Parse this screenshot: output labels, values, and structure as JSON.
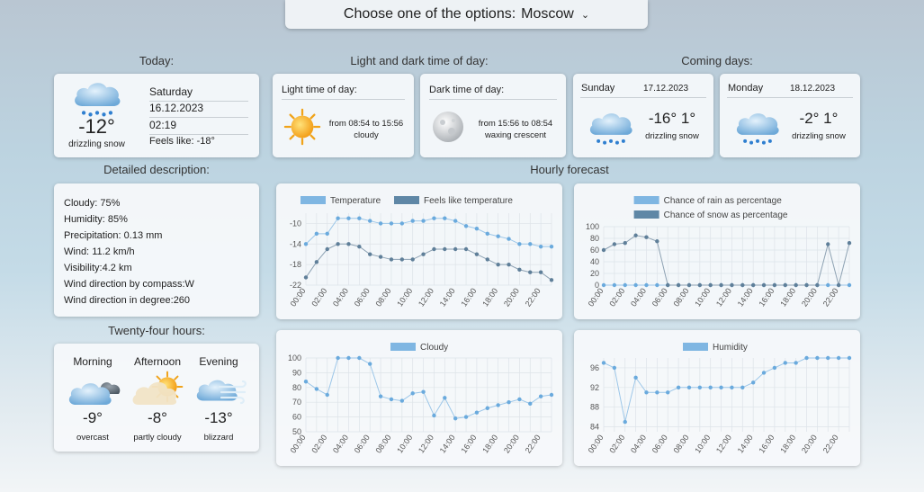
{
  "header": {
    "prompt": "Choose one of the options:",
    "city": "Moscow"
  },
  "sections": {
    "today": "Today:",
    "light_dark": "Light and dark time of day:",
    "coming": "Coming days:",
    "detailed": "Detailed description:",
    "hourly": "Hourly forecast",
    "twentyfour": "Twenty-four hours:"
  },
  "today": {
    "day": "Saturday",
    "date": "16.12.2023",
    "time": "02:19",
    "feels": "Feels like: -18°",
    "temp": "-12°",
    "desc": "drizzling snow",
    "icon": "snow-cloud-icon"
  },
  "light": {
    "title": "Light time of day:",
    "range": "from 08:54 to 15:56",
    "desc": "cloudy",
    "icon": "sun-icon"
  },
  "dark": {
    "title": "Dark time of day:",
    "range": "from 15:56 to 08:54",
    "desc": "waxing crescent",
    "icon": "moon-icon"
  },
  "coming": [
    {
      "day": "Sunday",
      "date": "17.12.2023",
      "temp": "-16° 1°",
      "desc": "drizzling snow",
      "icon": "snow-cloud-icon"
    },
    {
      "day": "Monday",
      "date": "18.12.2023",
      "temp": "-2° 1°",
      "desc": "drizzling snow",
      "icon": "snow-cloud-icon"
    }
  ],
  "detailed": [
    {
      "label": "Cloudy:",
      "value": "75%"
    },
    {
      "label": "Humidity:",
      "value": "85%"
    },
    {
      "label": "Precipitation:",
      "value": "0.13 mm"
    },
    {
      "label": "Wind:",
      "value": "11.2 km/h"
    },
    {
      "label": "Visibility:",
      "value": "4.2 km"
    },
    {
      "label": "Wind direction by compass:",
      "value": "W"
    },
    {
      "label": "Wind direction in degree:",
      "value": "260"
    }
  ],
  "day_parts": [
    {
      "name": "Morning",
      "temp": "-9°",
      "desc": "overcast",
      "icon": "overcast-icon"
    },
    {
      "name": "Afternoon",
      "temp": "-8°",
      "desc": "partly cloudy",
      "icon": "partly-cloudy-icon"
    },
    {
      "name": "Evening",
      "temp": "-13°",
      "desc": "blizzard",
      "icon": "blizzard-icon"
    }
  ],
  "colors": {
    "series_light": "#7fb6e2",
    "series_dark": "#5f87a6",
    "grid": "#dde3e8"
  },
  "chart_data": [
    {
      "type": "line",
      "x": [
        "00:00",
        "01:00",
        "02:00",
        "03:00",
        "04:00",
        "05:00",
        "06:00",
        "07:00",
        "08:00",
        "09:00",
        "10:00",
        "11:00",
        "12:00",
        "13:00",
        "14:00",
        "15:00",
        "16:00",
        "17:00",
        "18:00",
        "19:00",
        "20:00",
        "21:00",
        "22:00",
        "23:00"
      ],
      "xticks": [
        "00:00",
        "02:00",
        "04:00",
        "06:00",
        "08:00",
        "10:00",
        "12:00",
        "14:00",
        "16:00",
        "18:00",
        "20:00",
        "22:00"
      ],
      "ylim": [
        -22,
        -8
      ],
      "yticks": [
        -10,
        -14,
        -18,
        -22
      ],
      "series": [
        {
          "name": "Temperature",
          "values": [
            -14,
            -12,
            -12,
            -9,
            -9,
            -9,
            -9.5,
            -10,
            -10,
            -10,
            -9.5,
            -9.5,
            -9,
            -9,
            -9.5,
            -10.5,
            -11,
            -12,
            -12.5,
            -13,
            -14,
            -14,
            -14.5,
            -14.5
          ]
        },
        {
          "name": "Feels like temperature",
          "values": [
            -20.5,
            -17.5,
            -15,
            -14,
            -14,
            -14.5,
            -16,
            -16.5,
            -17,
            -17,
            -17,
            -16,
            -15,
            -15,
            -15,
            -15,
            -16,
            -17,
            -18,
            -18,
            -19,
            -19.5,
            -19.5,
            -21
          ]
        }
      ],
      "grid": true,
      "legend": "top"
    },
    {
      "type": "line",
      "x": [
        "00:00",
        "01:00",
        "02:00",
        "03:00",
        "04:00",
        "05:00",
        "06:00",
        "07:00",
        "08:00",
        "09:00",
        "10:00",
        "11:00",
        "12:00",
        "13:00",
        "14:00",
        "15:00",
        "16:00",
        "17:00",
        "18:00",
        "19:00",
        "20:00",
        "21:00",
        "22:00",
        "23:00"
      ],
      "xticks": [
        "00:00",
        "02:00",
        "04:00",
        "06:00",
        "08:00",
        "10:00",
        "12:00",
        "14:00",
        "16:00",
        "18:00",
        "20:00",
        "22:00"
      ],
      "ylim": [
        0,
        100
      ],
      "yticks": [
        100,
        80,
        60,
        40,
        20,
        0
      ],
      "series": [
        {
          "name": "Chance of rain as percentage",
          "values": [
            0,
            0,
            0,
            0,
            0,
            0,
            0,
            0,
            0,
            0,
            0,
            0,
            0,
            0,
            0,
            0,
            0,
            0,
            0,
            0,
            0,
            0,
            0,
            0
          ]
        },
        {
          "name": "Chance of snow as percentage",
          "values": [
            60,
            70,
            72,
            85,
            82,
            75,
            0,
            0,
            0,
            0,
            0,
            0,
            0,
            0,
            0,
            0,
            0,
            0,
            0,
            0,
            0,
            70,
            0,
            72
          ]
        }
      ],
      "grid": true,
      "legend": "top"
    },
    {
      "type": "line",
      "x": [
        "00:00",
        "01:00",
        "02:00",
        "03:00",
        "04:00",
        "05:00",
        "06:00",
        "07:00",
        "08:00",
        "09:00",
        "10:00",
        "11:00",
        "12:00",
        "13:00",
        "14:00",
        "15:00",
        "16:00",
        "17:00",
        "18:00",
        "19:00",
        "20:00",
        "21:00",
        "22:00",
        "23:00"
      ],
      "xticks": [
        "00:00",
        "02:00",
        "04:00",
        "06:00",
        "08:00",
        "10:00",
        "12:00",
        "14:00",
        "16:00",
        "18:00",
        "20:00",
        "22:00"
      ],
      "ylim": [
        50,
        100
      ],
      "yticks": [
        100,
        90,
        80,
        70,
        60,
        50
      ],
      "series": [
        {
          "name": "Cloudy",
          "values": [
            84,
            79,
            75,
            100,
            100,
            100,
            96,
            74,
            72,
            71,
            76,
            77,
            61,
            73,
            59,
            60,
            63,
            66,
            68,
            70,
            72,
            69,
            74,
            75
          ]
        }
      ],
      "grid": true,
      "legend": "top"
    },
    {
      "type": "line",
      "x": [
        "00:00",
        "01:00",
        "02:00",
        "03:00",
        "04:00",
        "05:00",
        "06:00",
        "07:00",
        "08:00",
        "09:00",
        "10:00",
        "11:00",
        "12:00",
        "13:00",
        "14:00",
        "15:00",
        "16:00",
        "17:00",
        "18:00",
        "19:00",
        "20:00",
        "21:00",
        "22:00",
        "23:00"
      ],
      "xticks": [
        "00:00",
        "02:00",
        "04:00",
        "06:00",
        "08:00",
        "10:00",
        "12:00",
        "14:00",
        "16:00",
        "18:00",
        "20:00",
        "22:00"
      ],
      "ylim": [
        83,
        98
      ],
      "yticks": [
        96,
        92,
        88,
        84
      ],
      "series": [
        {
          "name": "Humidity",
          "values": [
            97,
            96,
            85,
            94,
            91,
            91,
            91,
            92,
            92,
            92,
            92,
            92,
            92,
            92,
            93,
            95,
            96,
            97,
            97,
            98,
            98,
            98,
            98,
            98
          ]
        }
      ],
      "grid": true,
      "legend": "top"
    }
  ]
}
